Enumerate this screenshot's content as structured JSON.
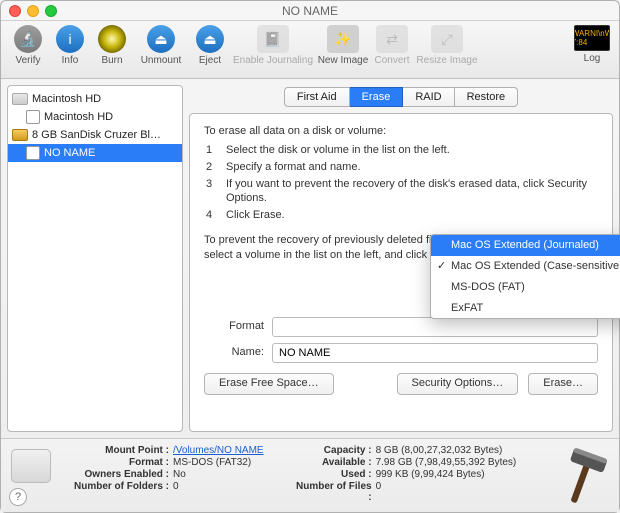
{
  "window": {
    "title": "NO NAME"
  },
  "toolbar": {
    "verify": "Verify",
    "info": "Info",
    "burn": "Burn",
    "unmount": "Unmount",
    "eject": "Eject",
    "enable_journaling": "Enable Journaling",
    "new_image": "New Image",
    "convert": "Convert",
    "resize_image": "Resize Image",
    "log": "Log",
    "log_badge": "WARNI\\nW 7:84"
  },
  "sidebar": {
    "items": [
      {
        "label": "Macintosh HD",
        "icon": "hdd",
        "level": 0
      },
      {
        "label": "Macintosh HD",
        "icon": "vol",
        "level": 1
      },
      {
        "label": "8 GB SanDisk Cruzer Bl…",
        "icon": "ext",
        "level": 0
      },
      {
        "label": "NO NAME",
        "icon": "vol",
        "level": 1,
        "selected": true
      }
    ]
  },
  "tabs": {
    "first_aid": "First Aid",
    "erase": "Erase",
    "raid": "RAID",
    "restore": "Restore"
  },
  "erase_panel": {
    "intro": "To erase all data on a disk or volume:",
    "step1": "Select the disk or volume in the list on the left.",
    "step2": "Specify a format and name.",
    "step3": "If you want to prevent the recovery of the disk's erased data, click Security Options.",
    "step4": "Click Erase.",
    "prevent": "To prevent the recovery of previously deleted files without erasing the volume, select a volume in the list on the left, and click Erase Free Space.",
    "format_label": "Format",
    "name_label": "Name:",
    "name_value": "NO NAME"
  },
  "format_options": [
    {
      "label": "Mac OS Extended (Journaled)",
      "selected": true
    },
    {
      "label": "Mac OS Extended (Case-sensitive, Journaled)",
      "checked": true
    },
    {
      "label": "MS-DOS (FAT)"
    },
    {
      "label": "ExFAT"
    }
  ],
  "buttons": {
    "erase_free_space": "Erase Free Space…",
    "security_options": "Security Options…",
    "erase": "Erase…"
  },
  "footer": {
    "mount_point_label": "Mount Point :",
    "mount_point_value": "/Volumes/NO NAME",
    "format_label": "Format :",
    "format_value": "MS-DOS (FAT32)",
    "owners_label": "Owners Enabled :",
    "owners_value": "No",
    "folders_label": "Number of Folders :",
    "folders_value": "0",
    "capacity_label": "Capacity :",
    "capacity_value": "8 GB (8,00,27,32,032 Bytes)",
    "available_label": "Available :",
    "available_value": "7.98 GB (7,98,49,55,392 Bytes)",
    "used_label": "Used :",
    "used_value": "999 KB (9,99,424 Bytes)",
    "files_label": "Number of Files :",
    "files_value": "0"
  }
}
